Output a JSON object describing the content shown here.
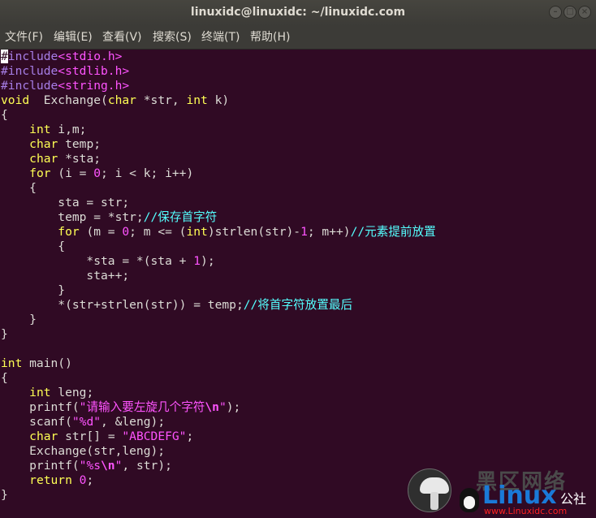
{
  "window": {
    "title": "linuxidc@linuxidc: ~/linuxidc.com",
    "buttons": {
      "minimize": "–",
      "maximize": "□",
      "close": "×"
    }
  },
  "menu": [
    {
      "label": "文件(F)"
    },
    {
      "label": "编辑(E)"
    },
    {
      "label": "查看(V)"
    },
    {
      "label": "搜索(S)"
    },
    {
      "label": "终端(T)"
    },
    {
      "label": "帮助(H)"
    }
  ],
  "code_lines": [
    [
      [
        "cur",
        "#"
      ],
      [
        "pp",
        "include"
      ],
      [
        "pp2",
        "<stdio.h>"
      ]
    ],
    [
      [
        "pp",
        "#include"
      ],
      [
        "pp2",
        "<stdlib.h>"
      ]
    ],
    [
      [
        "pp",
        "#include"
      ],
      [
        "pp2",
        "<string.h>"
      ]
    ],
    [
      [
        "kw",
        "void"
      ],
      [
        "",
        "  Exchange("
      ],
      [
        "kw",
        "char"
      ],
      [
        "",
        " *str, "
      ],
      [
        "kw",
        "int"
      ],
      [
        "",
        " k)"
      ]
    ],
    [
      [
        "",
        "{"
      ]
    ],
    [
      [
        "",
        "    "
      ],
      [
        "kw",
        "int"
      ],
      [
        "",
        " i,m;"
      ]
    ],
    [
      [
        "",
        "    "
      ],
      [
        "kw",
        "char"
      ],
      [
        "",
        " temp;"
      ]
    ],
    [
      [
        "",
        "    "
      ],
      [
        "kw",
        "char"
      ],
      [
        "",
        " *sta;"
      ]
    ],
    [
      [
        "",
        "    "
      ],
      [
        "kw",
        "for"
      ],
      [
        "",
        " (i = "
      ],
      [
        "num",
        "0"
      ],
      [
        "",
        "; i < k; i++)"
      ]
    ],
    [
      [
        "",
        "    {"
      ]
    ],
    [
      [
        "",
        "        sta = str;"
      ]
    ],
    [
      [
        "",
        "        temp = *str;"
      ],
      [
        "cm",
        "//保存首字符"
      ]
    ],
    [
      [
        "",
        "        "
      ],
      [
        "kw",
        "for"
      ],
      [
        "",
        " (m = "
      ],
      [
        "num",
        "0"
      ],
      [
        "",
        "; m <= ("
      ],
      [
        "kw",
        "int"
      ],
      [
        "",
        ")strlen(str)-"
      ],
      [
        "num",
        "1"
      ],
      [
        "",
        "; m++)"
      ],
      [
        "cm",
        "//元素提前放置"
      ]
    ],
    [
      [
        "",
        "        {"
      ]
    ],
    [
      [
        "",
        "            *sta = *(sta + "
      ],
      [
        "num",
        "1"
      ],
      [
        "",
        ");"
      ]
    ],
    [
      [
        "",
        "            sta++;"
      ]
    ],
    [
      [
        "",
        "        }"
      ]
    ],
    [
      [
        "",
        "        *(str+strlen(str)) = temp;"
      ],
      [
        "cm",
        "//将首字符放置最后"
      ]
    ],
    [
      [
        "",
        "    }"
      ]
    ],
    [
      [
        "",
        "}"
      ]
    ],
    [
      [
        "",
        ""
      ]
    ],
    [
      [
        "kw",
        "int"
      ],
      [
        "",
        " main()"
      ]
    ],
    [
      [
        "",
        "{"
      ]
    ],
    [
      [
        "",
        "    "
      ],
      [
        "kw",
        "int"
      ],
      [
        "",
        " leng;"
      ]
    ],
    [
      [
        "",
        "    printf("
      ],
      [
        "str",
        "\"请输入要左旋几个字符"
      ],
      [
        "esc",
        "\\n"
      ],
      [
        "str",
        "\""
      ],
      [
        "",
        ");"
      ]
    ],
    [
      [
        "",
        "    scanf("
      ],
      [
        "str",
        "\"%d\""
      ],
      [
        "",
        ", &leng);"
      ]
    ],
    [
      [
        "",
        "    "
      ],
      [
        "kw",
        "char"
      ],
      [
        "",
        " str[] = "
      ],
      [
        "str",
        "\"ABCDEFG\""
      ],
      [
        "",
        ";"
      ]
    ],
    [
      [
        "",
        "    Exchange(str,leng);"
      ]
    ],
    [
      [
        "",
        "    printf("
      ],
      [
        "str",
        "\"%s"
      ],
      [
        "esc",
        "\\n"
      ],
      [
        "str",
        "\""
      ],
      [
        "",
        ", str);"
      ]
    ],
    [
      [
        "",
        "    "
      ],
      [
        "kw",
        "return"
      ],
      [
        "",
        ""
      ],
      [
        "num",
        " 0"
      ],
      [
        "",
        ";"
      ]
    ],
    [
      [
        "",
        "}"
      ]
    ]
  ],
  "watermark": {
    "cn": "黑区网络",
    "linux": "Linux",
    "gongshe": "公社",
    "url": "www.Linuxidc.com"
  },
  "colors": {
    "terminal_bg": "#300a24",
    "text": "#dcdcd6",
    "keyword": "#ffff54",
    "preprocessor": "#a77ee7",
    "string": "#ff54ff",
    "comment": "#54ffff"
  }
}
